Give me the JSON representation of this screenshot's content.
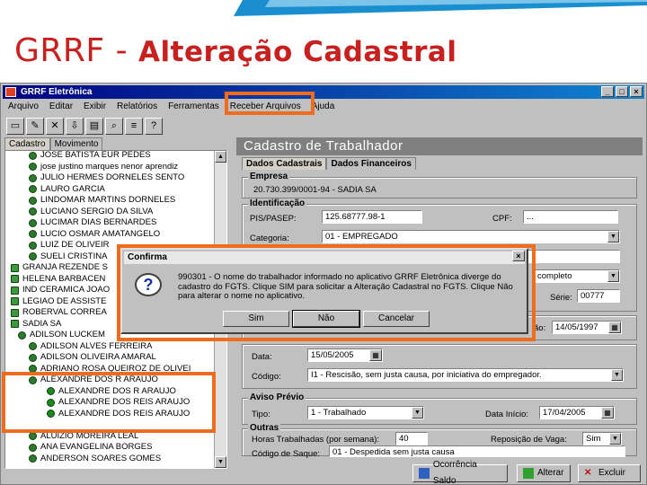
{
  "slide": {
    "title_main": "GRRF - ",
    "title_sub": "Alteração Cadastral",
    "accent": "#c8201e",
    "highlight": "#ee6c1e"
  },
  "window": {
    "title": "GRRF Eletrônica",
    "menu": [
      "Arquivo",
      "Editar",
      "Exibir",
      "Relatórios",
      "Ferramentas",
      "Receber Arquivos",
      "Ajuda"
    ],
    "tb_min": "_",
    "tb_max": "□",
    "tb_close": "×"
  },
  "left": {
    "tabs": [
      "Cadastro",
      "Movimento"
    ],
    "tree": [
      "JOSE BATISTA EUR PEDES",
      "jose justino marques nenor aprendiz",
      "JULIO HERMES DORNELES SENTO",
      "LAURO GARCIA",
      "LINDOMAR MARTINS DORNELES",
      "LUCIANO SERGIO DA SILVA",
      "LUCIMAR DIAS BERNARDES",
      "LUCIO OSMAR AMATANGELO",
      "LUIZ DE OLIVEIR",
      "SUELI CRISTINA",
      "GRANJA REZENDE S",
      "HELENA BARBACEN",
      "IND CERAMICA JOAO",
      "LEGIAO DE ASSISTE",
      "ROBERVAL CORREA",
      "SADIA SA",
      "ADILSON LUCKEM",
      "ADILSON ALVES FERREIRA",
      "ADILSON OLIVEIRA AMARAL",
      "ADRIANO ROSA QUEIROZ DE OLIVEI",
      "ALEXANDRE DOS R ARAUJO",
      "ALEXANDRE DOS R ARAUJO",
      "ALEXANDRE DOS REIS ARAUJO",
      "ALEXANDRE DOS REIS ARAUJO",
      "",
      "ALUIZIO MOREIRA LEAL",
      "ANA EVANGELINA BORGES",
      "ANDERSON SOARES GOMES"
    ]
  },
  "right": {
    "header": "Cadastro de Trabalhador",
    "tabs": [
      "Dados Cadastrais",
      "Dados Financeiros"
    ],
    "empresa_label": "Empresa",
    "empresa_value": "20.730.399/0001-94 - SADIA SA",
    "identificacao_label": "Identificação",
    "pis_label": "PIS/PASEP:",
    "pis_value": "125.68777.98-1",
    "cpf_label": "CPF:",
    "cpf_value": "...",
    "categoria_label": "Categoria:",
    "categoria_value": "01 - EMPREGADO",
    "instrucao_value": "completo",
    "serie_label": "Série:",
    "serie_value": "00777",
    "admissao_label": "ão:",
    "admissao_value": "14/05/1997",
    "data_label": "Data:",
    "data_value": "15/05/2005",
    "codigo_label": "Código:",
    "codigo_value": "I1 - Rescisão, sem justa causa, por iniciativa do empregador.",
    "aviso_label": "Aviso Prévio",
    "tipo_label": "Tipo:",
    "tipo_value": "1 - Trabalhado",
    "data_inicio_label": "Data Início:",
    "data_inicio_value": "17/04/2005",
    "outras_label": "Outras",
    "horas_label": "Horas Trabalhadas (por semana):",
    "horas_value": "40",
    "reposicao_label": "Reposição de Vaga:",
    "reposicao_value": "Sim",
    "codigo_saque_label": "Código de Saque:",
    "codigo_saque_value": "01 - Despedida sem justa causa"
  },
  "bottom": [
    "Ocorrência Saldo",
    "Alterar",
    "Excluir"
  ],
  "dialog": {
    "title": "Confirma",
    "message": "990301 - O nome do trabalhador informado no aplicativo GRRF Eletrônica diverge do cadastro do FGTS. Clique SIM para solicitar a Alteração Cadastral no FGTS. Clique Não para alterar o nome no aplicativo.",
    "buttons": [
      "Sim",
      "Não",
      "Cancelar"
    ]
  }
}
